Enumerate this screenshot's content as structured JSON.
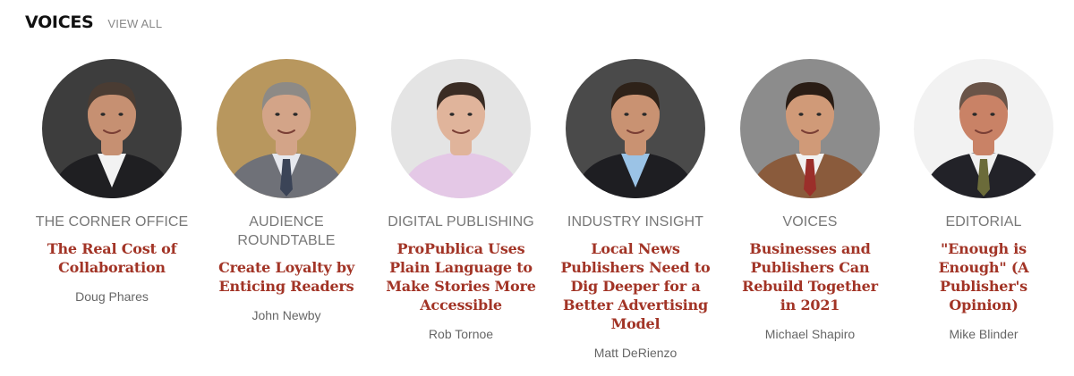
{
  "header": {
    "title": "VOICES",
    "view_all": "VIEW ALL"
  },
  "cards": [
    {
      "category": "THE CORNER OFFICE",
      "headline": "The Real Cost of Collaboration",
      "author": "Doug Phares",
      "bg": "#3d3d3d",
      "suit": "#1f1f22",
      "shirt": "#f2f2f2",
      "skin": "#c69072",
      "hair": "#4a3c33",
      "tie": ""
    },
    {
      "category": "AUDIENCE ROUNDTABLE",
      "headline": "Create Loyalty by Enticing Readers",
      "author": "John Newby",
      "bg": "#b8975e",
      "suit": "#6f7178",
      "shirt": "#e6e8ee",
      "skin": "#d3a488",
      "hair": "#8d8a86",
      "tie": "#3b4457"
    },
    {
      "category": "DIGITAL PUBLISHING",
      "headline": "ProPublica Uses Plain Language to Make Stories More Accessible",
      "author": "Rob Tornoe",
      "bg": "#e4e4e4",
      "suit": "#e4c8e6",
      "shirt": "#e4c8e6",
      "skin": "#e0b49b",
      "hair": "#3a2c24",
      "tie": ""
    },
    {
      "category": "INDUSTRY INSIGHT",
      "headline": "Local News Publishers Need to Dig Deeper for a Better Advertising Model",
      "author": "Matt DeRienzo",
      "bg": "#4a4a4a",
      "suit": "#1e1e22",
      "shirt": "#9bc3e6",
      "skin": "#c99272",
      "hair": "#2e2219",
      "tie": ""
    },
    {
      "category": "VOICES",
      "headline": "Businesses and Publishers Can Rebuild Together in 2021",
      "author": "Michael Shapiro",
      "bg": "#8c8c8c",
      "suit": "#8a5b3c",
      "shirt": "#f2f2f2",
      "skin": "#d09a78",
      "hair": "#2a1d15",
      "tie": "#9b2f2a"
    },
    {
      "category": "EDITORIAL",
      "headline": "\"Enough is Enough\" (A Publisher's Opinion)",
      "author": "Mike Blinder",
      "bg": "#f2f2f2",
      "suit": "#222228",
      "shirt": "#f0f0f0",
      "skin": "#c98266",
      "hair": "#6a5448",
      "tie": "#6b6b3a"
    }
  ]
}
